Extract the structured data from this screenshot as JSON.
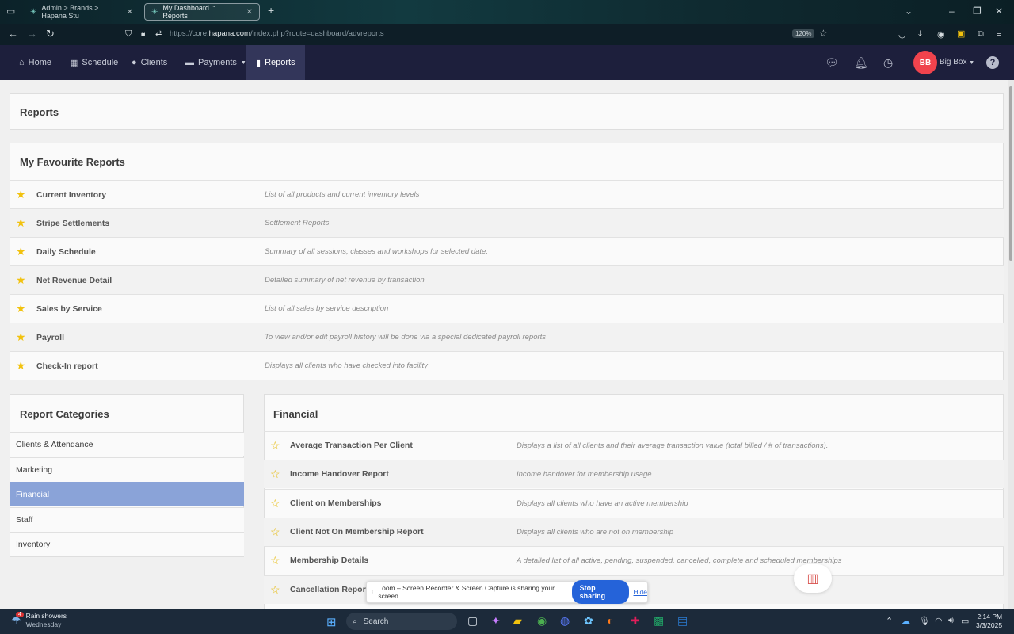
{
  "browser": {
    "tabs": [
      {
        "label": "Admin > Brands > Hapana Stu"
      },
      {
        "label": "My Dashboard :: Reports"
      }
    ],
    "url_prefix": "https://core.",
    "url_domain": "hapana.com",
    "url_suffix": "/index.php?route=dashboard/advreports",
    "zoom": "120%"
  },
  "nav": {
    "items": [
      {
        "label": "Home"
      },
      {
        "label": "Schedule"
      },
      {
        "label": "Clients"
      },
      {
        "label": "Payments"
      },
      {
        "label": "Reports"
      }
    ],
    "user_initials": "BB",
    "user_name": "Big Box",
    "help": "?"
  },
  "page": {
    "title": "Reports",
    "favourites_title": "My Favourite Reports",
    "favourites": [
      {
        "name": "Current Inventory",
        "desc": "List of all products and current inventory levels"
      },
      {
        "name": "Stripe Settlements",
        "desc": "Settlement Reports"
      },
      {
        "name": "Daily Schedule",
        "desc": "Summary of all sessions, classes and workshops for selected date."
      },
      {
        "name": "Net Revenue Detail",
        "desc": "Detailed summary of net revenue by transaction"
      },
      {
        "name": "Sales by Service",
        "desc": "List of all sales by service description"
      },
      {
        "name": "Payroll",
        "desc": "To view and/or edit payroll history will be done via a special dedicated payroll reports"
      },
      {
        "name": "Check-In report",
        "desc": "Displays all clients who have checked into facility"
      }
    ],
    "categories_title": "Report Categories",
    "categories": [
      {
        "label": "Clients & Attendance"
      },
      {
        "label": "Marketing"
      },
      {
        "label": "Financial"
      },
      {
        "label": "Staff"
      },
      {
        "label": "Inventory"
      }
    ],
    "selected_category": "Financial",
    "financial_title": "Financial",
    "financial_reports": [
      {
        "name": "Average Transaction Per Client",
        "desc": "Displays a list of all clients and their average transaction value (total billed / # of transactions)."
      },
      {
        "name": "Income Handover Report",
        "desc": "Income handover for membership usage"
      },
      {
        "name": "Client on Memberships",
        "desc": "Displays all clients who have an active membership"
      },
      {
        "name": "Client Not On Membership Report",
        "desc": "Displays all clients who are not on membership"
      },
      {
        "name": "Membership Details",
        "desc": "A detailed list of all active, pending, suspended, cancelled, complete and scheduled memberships"
      },
      {
        "name": "Cancellation Report",
        "desc": "embership"
      }
    ]
  },
  "loom": {
    "message": "Loom – Screen Recorder & Screen Capture is sharing your screen.",
    "stop_label": "Stop sharing",
    "hide_label": "Hide"
  },
  "taskbar": {
    "weather_badge": "4",
    "weather_line1": "Rain showers",
    "weather_line2": "Wednesday",
    "search_label": "Search",
    "time": "2:14 PM",
    "date": "3/3/2025"
  },
  "colors": {
    "nav_bg": "#1d1f3c",
    "selected_category": "#8aa3d8",
    "star": "#f2c20e",
    "avatar": "#f0434d",
    "loom_button": "#2563d9"
  }
}
